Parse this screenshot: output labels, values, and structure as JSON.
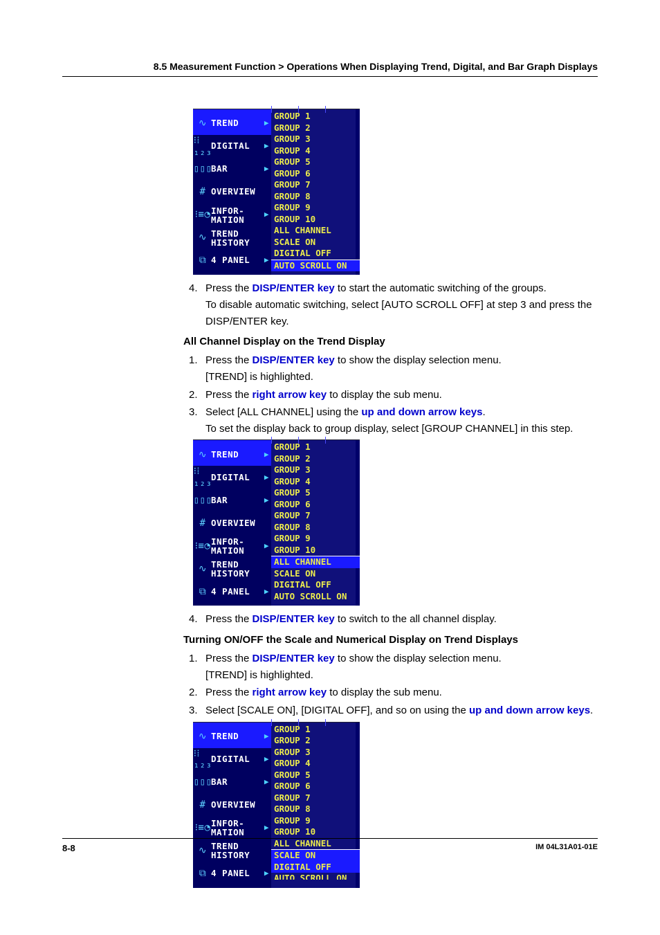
{
  "section_header": "8.5  Measurement Function > Operations When Displaying Trend, Digital, and Bar Graph Displays",
  "page_number": "8-8",
  "doc_id": "IM 04L31A01-01E",
  "menu_left": [
    {
      "label": "TREND",
      "arrow": true
    },
    {
      "label": "DIGITAL",
      "arrow": true
    },
    {
      "label": "BAR",
      "arrow": true
    },
    {
      "label": "OVERVIEW",
      "arrow": false
    },
    {
      "label": "INFOR-\nMATION",
      "arrow": true
    },
    {
      "label": "TREND\nHISTORY",
      "arrow": false
    },
    {
      "label": "4 PANEL",
      "arrow": true
    }
  ],
  "menu_right": [
    "GROUP 1",
    "GROUP 2",
    "GROUP 3",
    "GROUP 4",
    "GROUP 5",
    "GROUP 6",
    "GROUP 7",
    "GROUP 8",
    "GROUP 9",
    "GROUP 10",
    "ALL CHANNEL",
    "SCALE ON",
    "DIGITAL OFF",
    "AUTO SCROLL ON"
  ],
  "s4a_pre": "Press the ",
  "s4a_key": "DISP/ENTER key",
  "s4a_post": " to start the automatic switching of the groups.",
  "s4a_l2": "To disable automatic switching, select [AUTO SCROLL OFF] at step 3 and press the DISP/ENTER key.",
  "hA": "All Channel Display on the Trend Display",
  "a1_pre": "Press the ",
  "a1_key": "DISP/ENTER key",
  "a1_post": " to show the display selection menu.",
  "a1_l2": "[TREND] is highlighted.",
  "a2_pre": "Press the ",
  "a2_key": "right arrow key",
  "a2_post": " to display the sub menu.",
  "a3_pre": "Select [ALL CHANNEL] using the ",
  "a3_key": "up and down arrow keys",
  "a3_post": ".",
  "a3_l2": "To set the display back to group display, select [GROUP CHANNEL] in this step.",
  "a4_pre": "Press the ",
  "a4_key": "DISP/ENTER key",
  "a4_post": " to switch to the all channel display.",
  "hB": "Turning ON/OFF the Scale and Numerical Display on Trend Displays",
  "b1_pre": "Press the ",
  "b1_key": "DISP/ENTER key",
  "b1_post": " to show the display selection menu.",
  "b1_l2": "[TREND] is highlighted.",
  "b2_pre": "Press the ",
  "b2_key": "right arrow key",
  "b2_post": " to display the sub menu.",
  "b3_pre": "Select [SCALE ON], [DIGITAL OFF], and so on using the ",
  "b3_key": "up and down arrow keys",
  "b3_post": "."
}
